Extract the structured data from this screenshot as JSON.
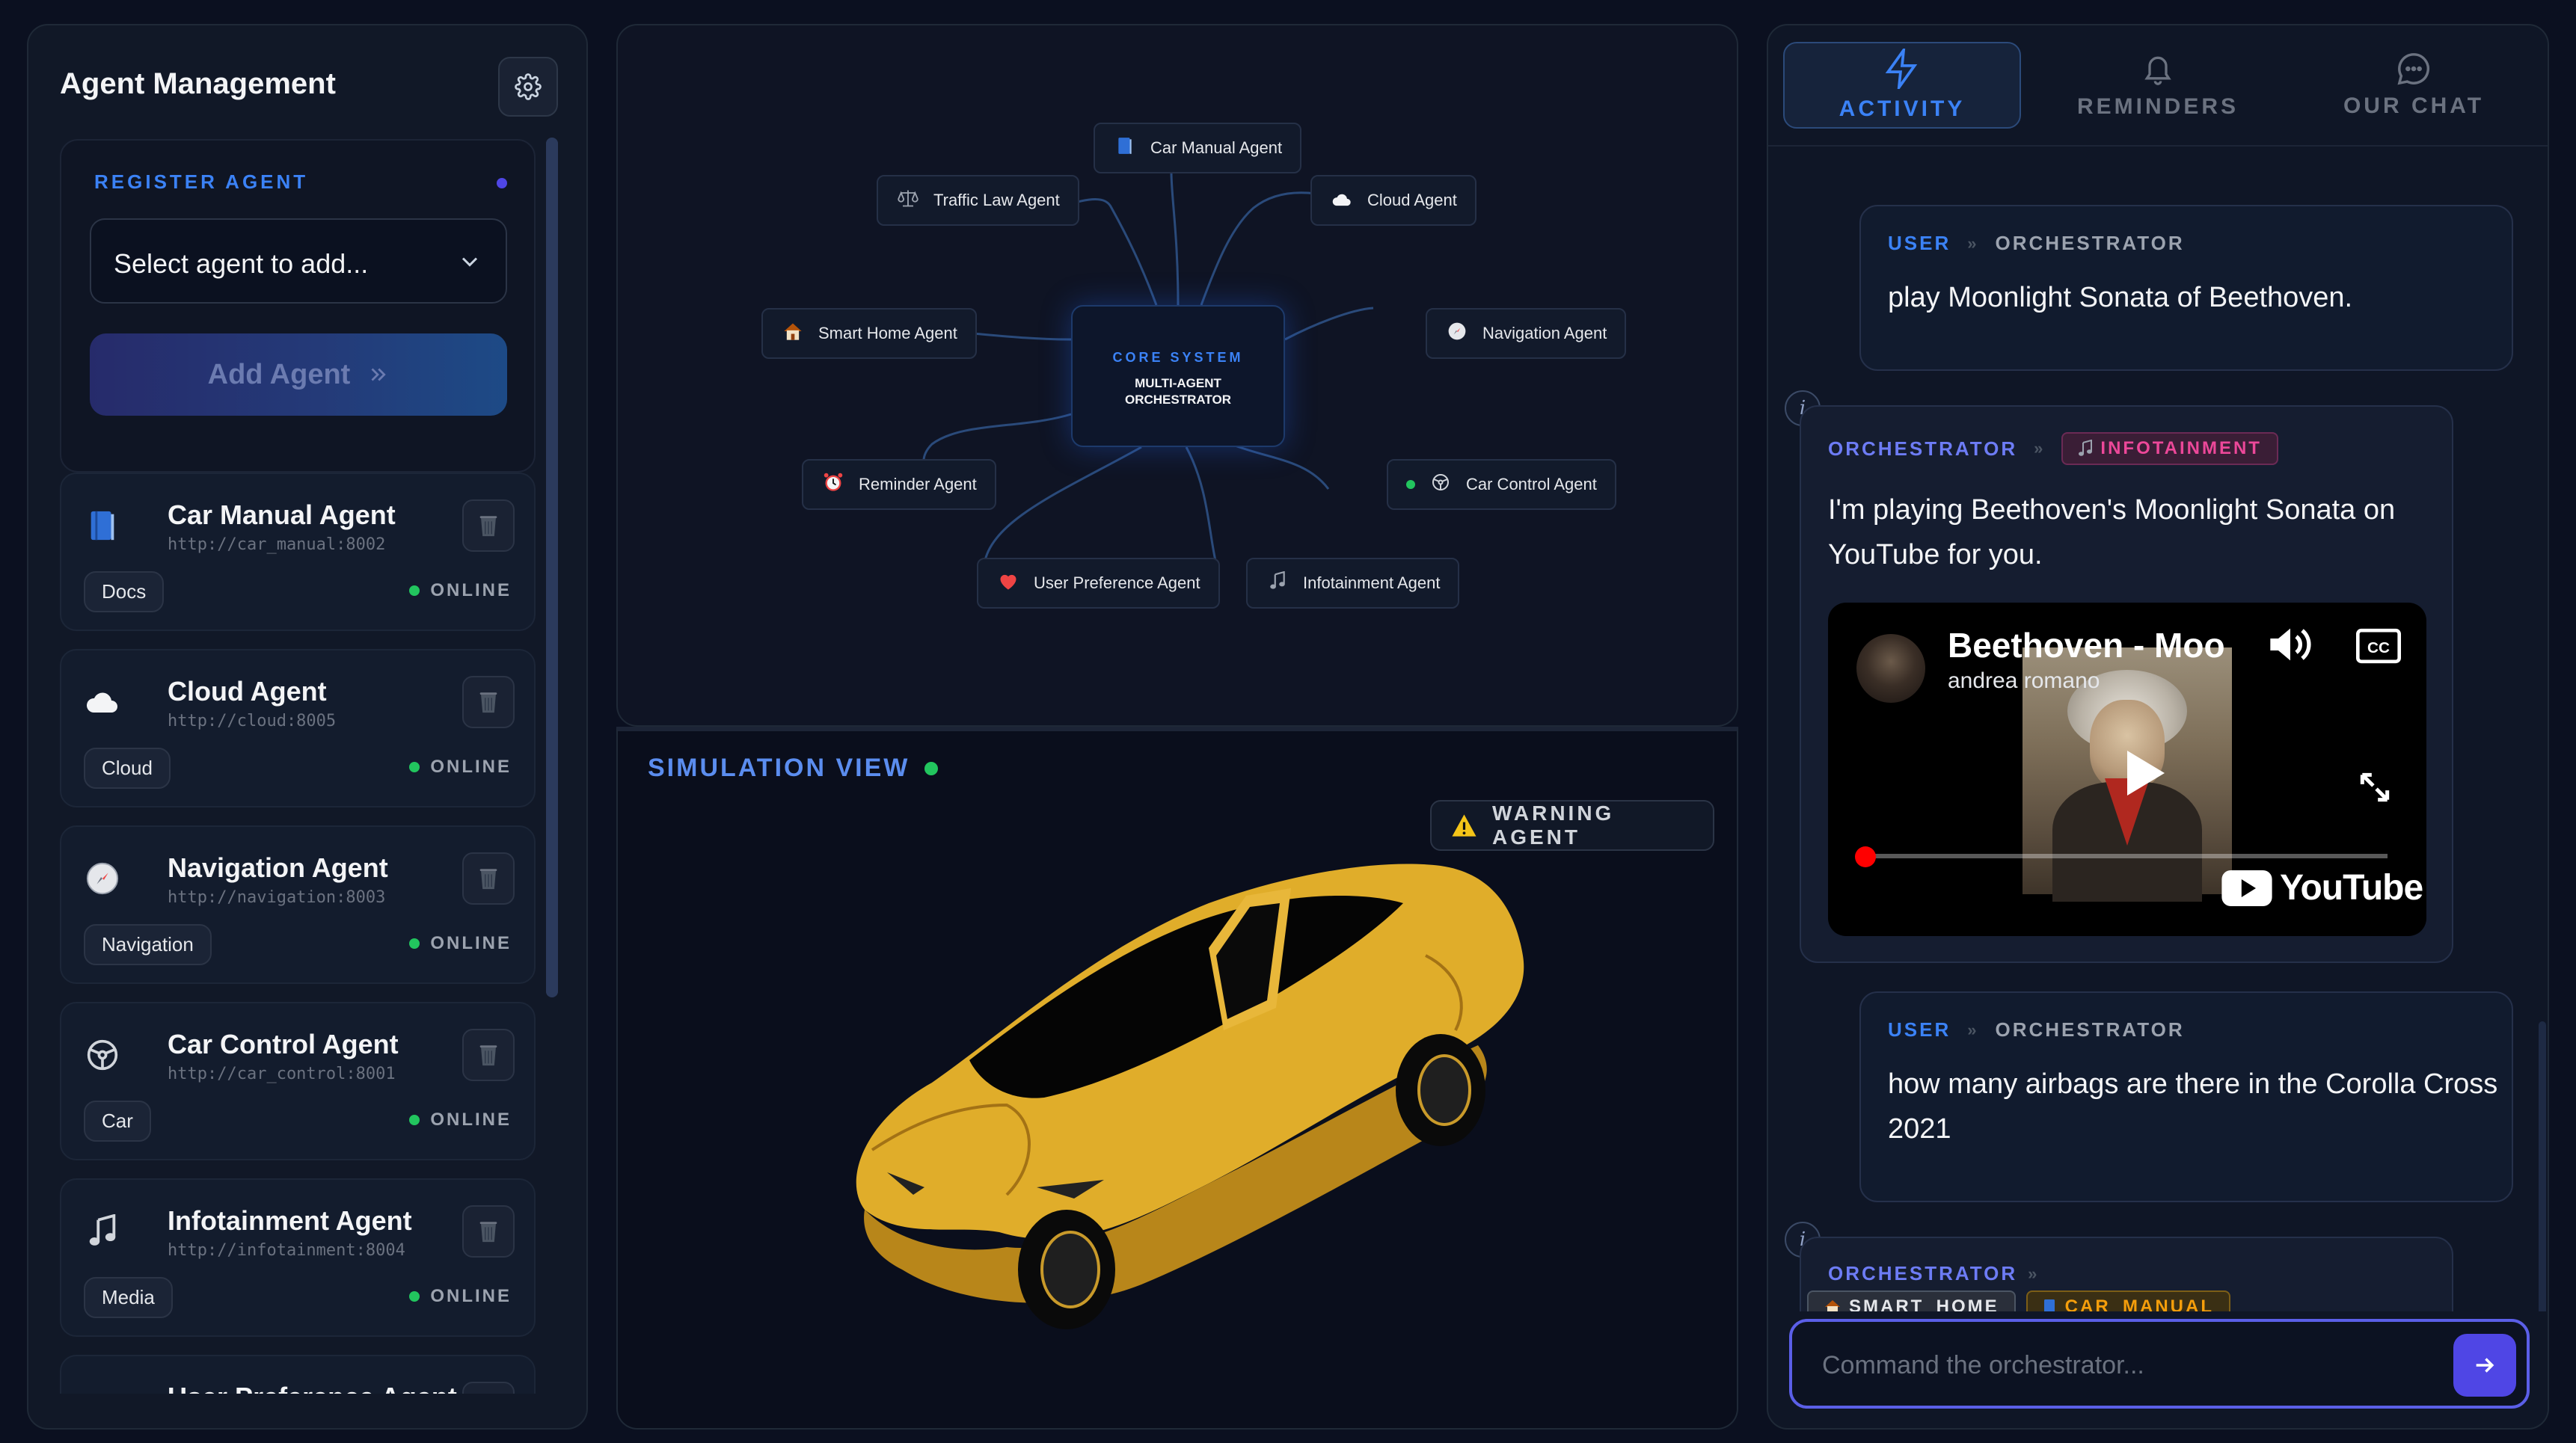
{
  "left_panel": {
    "title": "Agent Management",
    "register": {
      "label": "REGISTER AGENT",
      "select_placeholder": "Select agent to add...",
      "add_button": "Add Agent"
    },
    "agents": [
      {
        "name": "Car Manual Agent",
        "url": "http://car_manual:8002",
        "tag": "Docs",
        "status": "ONLINE",
        "icon": "book-icon"
      },
      {
        "name": "Cloud Agent",
        "url": "http://cloud:8005",
        "tag": "Cloud",
        "status": "ONLINE",
        "icon": "cloud-icon"
      },
      {
        "name": "Navigation Agent",
        "url": "http://navigation:8003",
        "tag": "Navigation",
        "status": "ONLINE",
        "icon": "compass-icon"
      },
      {
        "name": "Car Control Agent",
        "url": "http://car_control:8001",
        "tag": "Car",
        "status": "ONLINE",
        "icon": "steering-wheel-icon"
      },
      {
        "name": "Infotainment Agent",
        "url": "http://infotainment:8004",
        "tag": "Media",
        "status": "ONLINE",
        "icon": "music-icon"
      },
      {
        "name": "User Preference Agent",
        "url": "",
        "tag": "",
        "status": "",
        "icon": "heart-icon"
      }
    ]
  },
  "network": {
    "core_tag": "CORE SYSTEM",
    "core_title_line1": "MULTI-AGENT",
    "core_title_line2": "ORCHESTRATOR",
    "nodes": [
      {
        "name": "Car Manual Agent",
        "icon": "book-icon"
      },
      {
        "name": "Traffic Law Agent",
        "icon": "scales-icon"
      },
      {
        "name": "Cloud Agent",
        "icon": "cloud-icon"
      },
      {
        "name": "Smart Home Agent",
        "icon": "house-icon"
      },
      {
        "name": "Navigation Agent",
        "icon": "compass-icon"
      },
      {
        "name": "Reminder Agent",
        "icon": "alarm-clock-icon"
      },
      {
        "name": "Car Control Agent",
        "icon": "steering-wheel-icon"
      },
      {
        "name": "User Preference Agent",
        "icon": "heart-icon"
      },
      {
        "name": "Infotainment Agent",
        "icon": "music-icon"
      }
    ]
  },
  "simulation": {
    "title": "SIMULATION VIEW",
    "warning": "WARNING AGENT",
    "car_color": "#e0ad2a"
  },
  "right_panel": {
    "tabs": [
      {
        "label": "ACTIVITY",
        "icon": "lightning-icon",
        "active": true
      },
      {
        "label": "REMINDERS",
        "icon": "bell-icon",
        "active": false
      },
      {
        "label": "OUR CHAT",
        "icon": "chat-bubble-icon",
        "active": false
      }
    ],
    "messages": [
      {
        "from": "USER",
        "to": "ORCHESTRATOR",
        "text": "play Moonlight Sonata of Beethoven."
      },
      {
        "from": "ORCHESTRATOR",
        "to": "INFOTAINMENT",
        "text": "I'm playing Beethoven's Moonlight Sonata on YouTube for you.",
        "video": {
          "title": "Beethoven - Moo",
          "channel": "andrea romano",
          "brand": "YouTube",
          "progress": 0.0
        }
      },
      {
        "from": "USER",
        "to": "ORCHESTRATOR",
        "text": "how many airbags are there in the Corolla Cross 2021"
      },
      {
        "from": "ORCHESTRATOR",
        "targets": [
          "SMART_HOME",
          "CAR_MANUAL"
        ]
      }
    ],
    "command": {
      "placeholder": "Command the orchestrator...",
      "value": ""
    }
  },
  "colors": {
    "accent": "#3b82f6",
    "indigo": "#4f46e5",
    "online": "#22c55e",
    "infotainment": "#ec4899",
    "manual": "#f59e0b"
  }
}
